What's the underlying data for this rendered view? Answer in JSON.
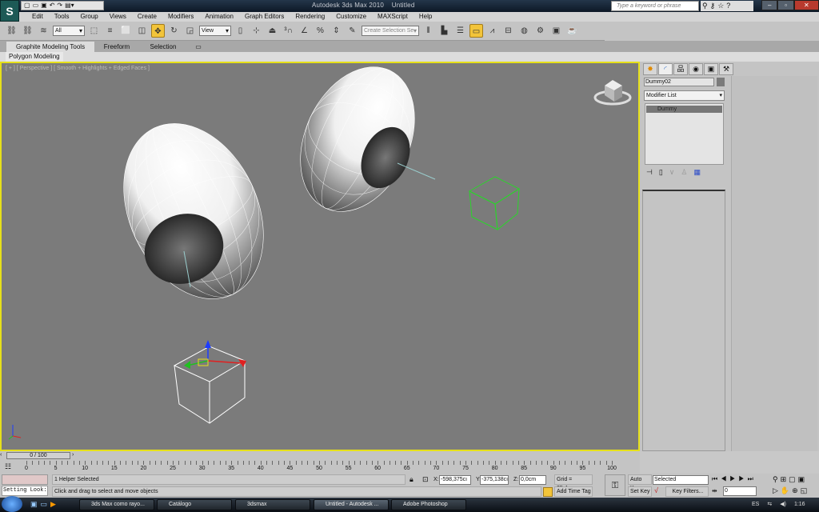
{
  "title": {
    "app": "Autodesk 3ds Max  2010",
    "doc": "Untitled",
    "search_placeholder": "Type a keyword or phrase",
    "window_buttons": [
      "–",
      "▫",
      "✕"
    ]
  },
  "menu": [
    "Edit",
    "Tools",
    "Group",
    "Views",
    "Create",
    "Modifiers",
    "Animation",
    "Graph Editors",
    "Rendering",
    "Customize",
    "MAXScript",
    "Help"
  ],
  "toolbar": {
    "selection_filter": "All",
    "reference_coord": "View",
    "named_selection": "Create Selection Se"
  },
  "ribbon": {
    "tabs": [
      "Graphite Modeling Tools",
      "Freeform",
      "Selection"
    ],
    "panel": "Polygon Modeling"
  },
  "viewport": {
    "label": "[ + ] [ Perspective ] [ Smooth + Highlights + Edged Faces ]",
    "accent": "#e6e01a"
  },
  "command_panel": {
    "object_name": "Dummy02",
    "modifier_list": "Modifier List",
    "stack": [
      "Dummy"
    ]
  },
  "timeline": {
    "frame": "0 / 100",
    "ticks": [
      0,
      5,
      10,
      15,
      20,
      25,
      30,
      35,
      40,
      45,
      50,
      55,
      60,
      65,
      70,
      75,
      80,
      85,
      90,
      95,
      100
    ]
  },
  "status": {
    "maxscript": "Setting Look:",
    "selected": "1 Helper Selected",
    "prompt": "Click and drag to select and move objects",
    "x": "-598,375cı",
    "y": "-375,138cı",
    "z": "0,0cm",
    "grid": "Grid = 25,4cm",
    "add_time_tag": "Add Time Tag",
    "auto_key": "Auto Key",
    "set_key": "Set Key",
    "key_mode": "Selected",
    "key_filters": "Key Filters...",
    "current_frame": "0"
  },
  "taskbar": {
    "items": [
      "3ds Max como rayo...",
      "Catálogo",
      "3dsmax",
      "Untitled - Autodesk ...",
      "Adobe Photoshop"
    ],
    "active": 3,
    "lang": "ES",
    "clock": "1:16"
  }
}
